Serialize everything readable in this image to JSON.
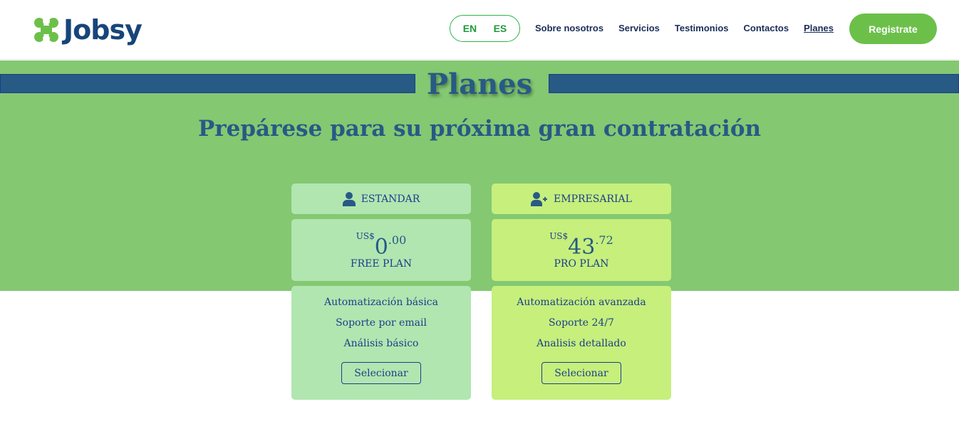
{
  "header": {
    "logo": "Jobsy",
    "lang": [
      "EN",
      "ES"
    ],
    "nav": [
      "Sobre nosotros",
      "Servicios",
      "Testimonios",
      "Contactos",
      "Planes"
    ],
    "active": "Planes",
    "register": "Registrate"
  },
  "hero": {
    "title": "Planes",
    "subtitle": "Prepárese para su próxima gran contratación"
  },
  "plans": [
    {
      "name": "ESTANDAR",
      "icon": "user-icon",
      "currency": "US$",
      "int": "0",
      "dec": ".00",
      "plan": "FREE PLAN",
      "features": [
        "Automatización básica",
        "Soporte por email",
        "Análisis básico"
      ],
      "button": "Selecionar",
      "color": "#b1e6b0"
    },
    {
      "name": "EMPRESARIAL",
      "icon": "user-plus-icon",
      "currency": "US$",
      "int": "43",
      "dec": ".72",
      "plan": "PRO PLAN",
      "features": [
        "Automatización avanzada",
        "Soporte 24/7",
        "Analisis detallado"
      ],
      "button": "Selecionar",
      "color": "#c6ef7c"
    }
  ],
  "colors": {
    "brand_blue": "#17457a",
    "brand_green": "#6cc04a",
    "hero_bg": "#84c872"
  }
}
